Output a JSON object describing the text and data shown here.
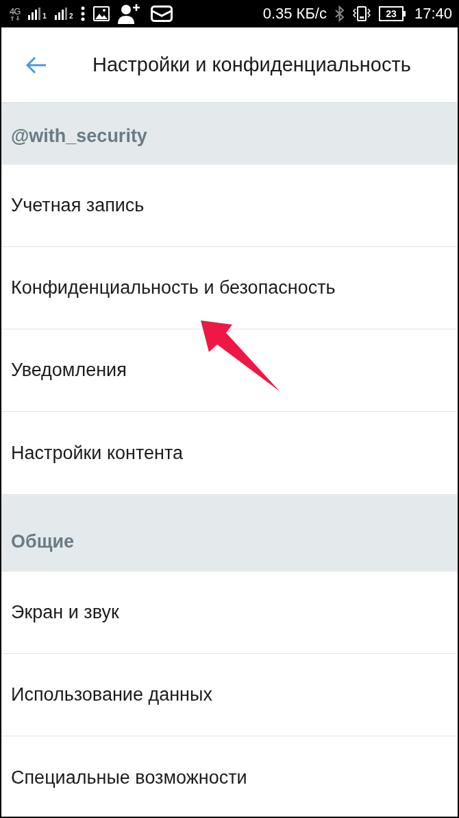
{
  "status_bar": {
    "network": "4G",
    "sims": [
      {
        "label": "1"
      },
      {
        "label": "2"
      }
    ],
    "speed": "0.35 КБ/с",
    "battery": "23",
    "time": "17:40"
  },
  "app_bar": {
    "title": "Настройки и конфиденциальность"
  },
  "sections": [
    {
      "title": "@with_security",
      "items": [
        "Учетная запись",
        "Конфиденциальность и безопасность",
        "Уведомления",
        "Настройки контента"
      ]
    },
    {
      "title": "Общие",
      "items": [
        "Экран и звук",
        "Использование данных",
        "Специальные возможности"
      ]
    }
  ]
}
